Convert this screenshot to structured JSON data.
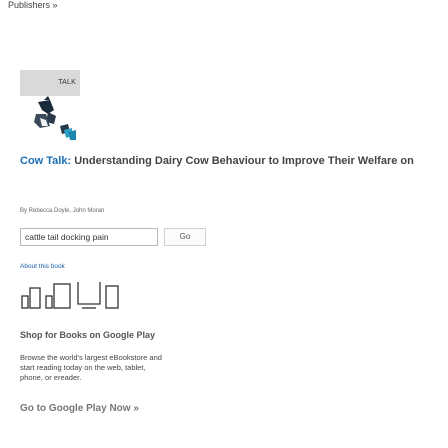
{
  "breadcrumb": "Publishers »",
  "cover": {
    "series_label": "TALK"
  },
  "book": {
    "series_prefix": "Cow Talk:",
    "title": "Understanding Dairy Cow Behaviour to Improve Their Welfare on",
    "authors": "By Rebecca Doyle, John Moran"
  },
  "search": {
    "value": "cattle tail docking pain",
    "go_label": "Go"
  },
  "about_link": "About this book",
  "shop": {
    "title": "Shop for Books on Google Play",
    "description": "Browse the world's largest eBookstore and start reading today on the web, tablet, phone, or ereader.",
    "link": "Go to Google Play Now »"
  },
  "icons": {
    "logo": "google-play-logo-icon"
  }
}
